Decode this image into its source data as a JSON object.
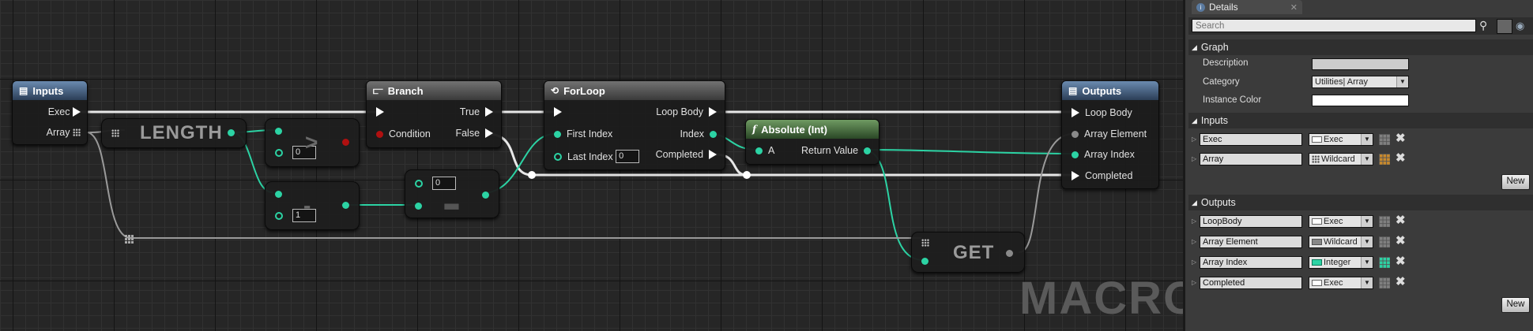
{
  "graph": {
    "watermark": "MACRO",
    "nodes": {
      "inputs": {
        "title": "Inputs",
        "pins": [
          "Exec",
          "Array"
        ]
      },
      "length": {
        "label": "LENGTH"
      },
      "greater": {
        "value": "0"
      },
      "subtract": {
        "value": "1"
      },
      "branch": {
        "title": "Branch",
        "condition": "Condition",
        "true_pin": "True",
        "false_pin": "False"
      },
      "select": {
        "value": "0"
      },
      "forloop": {
        "title": "ForLoop",
        "first_index": "First Index",
        "last_index": "Last Index",
        "last_index_value": "0",
        "loop_body": "Loop Body",
        "index": "Index",
        "completed": "Completed"
      },
      "absolute": {
        "title": "Absolute (Int)",
        "a": "A",
        "return_value": "Return Value"
      },
      "get": {
        "label": "GET"
      },
      "outputs": {
        "title": "Outputs",
        "pins": [
          "Loop Body",
          "Array Element",
          "Array Index",
          "Completed"
        ]
      }
    }
  },
  "details": {
    "tab_title": "Details",
    "search_placeholder": "Search",
    "sections": {
      "graph": "Graph",
      "inputs": "Inputs",
      "outputs": "Outputs"
    },
    "graph_props": {
      "description_label": "Description",
      "description_value": "",
      "category_label": "Category",
      "category_value": "Utilities| Array",
      "instance_color_label": "Instance Color"
    },
    "inputs": [
      {
        "name": "Exec",
        "type": "Exec"
      },
      {
        "name": "Array",
        "type": "Wildcard"
      }
    ],
    "outputs": [
      {
        "name": "LoopBody",
        "type": "Exec"
      },
      {
        "name": "Array Element",
        "type": "Wildcard"
      },
      {
        "name": "Array Index",
        "type": "Integer"
      },
      {
        "name": "Completed",
        "type": "Exec"
      }
    ],
    "new_label": "New",
    "colors": {
      "exec": "#ffffff",
      "integer": "#2cd3a4",
      "bool": "#b01010",
      "wildcard": "#8a8a8a"
    }
  }
}
